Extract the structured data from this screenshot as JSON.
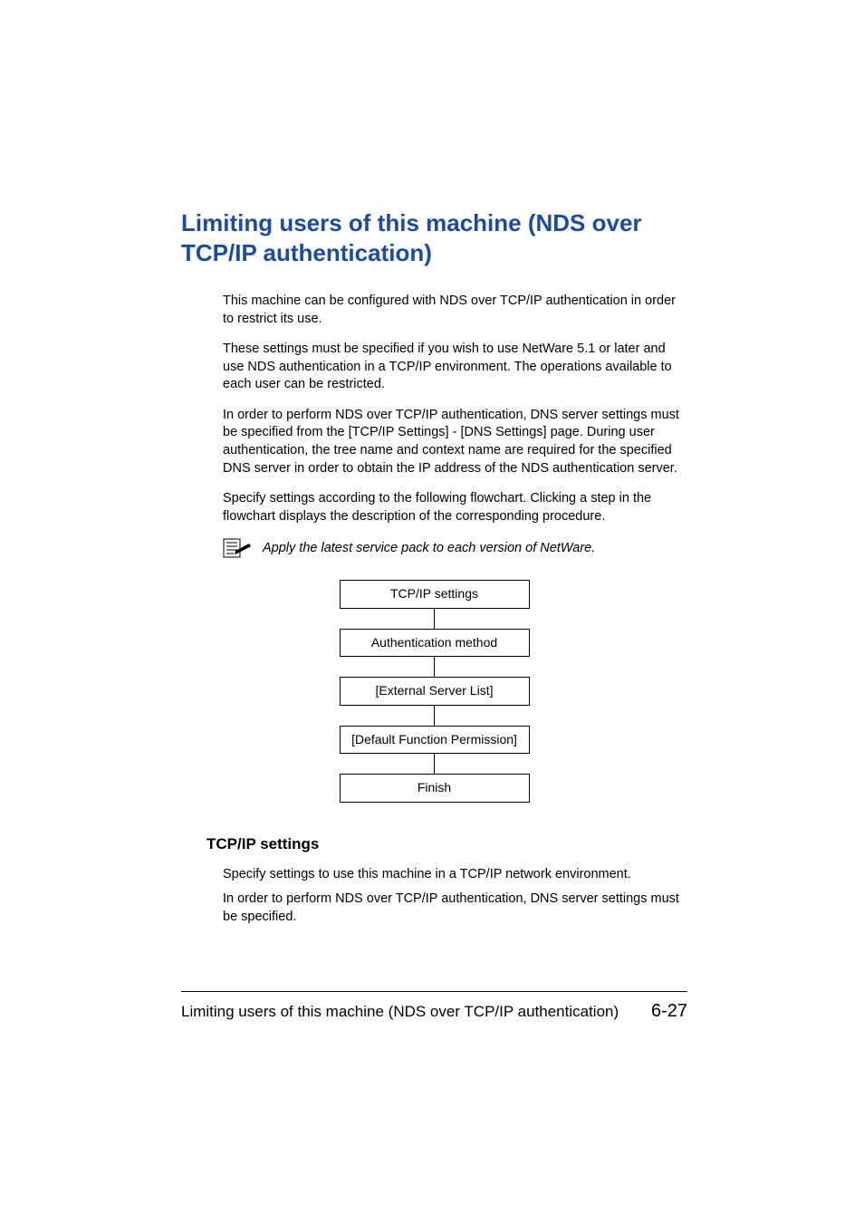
{
  "heading": "Limiting users of this machine (NDS over TCP/IP authentication)",
  "paragraphs": {
    "p1": "This machine can be configured with NDS over TCP/IP authentication in order to restrict its use.",
    "p2": "These settings must be specified if you wish to use NetWare 5.1 or later and use NDS authentication in a TCP/IP environment. The operations available to each user can be restricted.",
    "p3": "In order to perform NDS over TCP/IP authentication, DNS server settings must be specified from the [TCP/IP Settings] - [DNS Settings] page. During user authentication, the tree name and context name are required for the specified DNS server in order to obtain the IP address of the NDS authentication server.",
    "p4": "Specify settings according to the following flowchart. Clicking a step in the flowchart displays the description of the corresponding procedure."
  },
  "note": "Apply the latest service pack to each version of NetWare.",
  "flowchart": {
    "step1": "TCP/IP settings",
    "step2": "Authentication method",
    "step3": "[External Server List]",
    "step4": "[Default Function Permission]",
    "step5": "Finish"
  },
  "subheading": "TCP/IP settings",
  "subparas": {
    "sp1": "Specify settings to use this machine in a TCP/IP network environment.",
    "sp2": "In order to perform NDS over TCP/IP authentication, DNS server settings must be specified."
  },
  "footer": {
    "title": "Limiting users of this machine (NDS over TCP/IP authentication)",
    "page": "6-27"
  }
}
